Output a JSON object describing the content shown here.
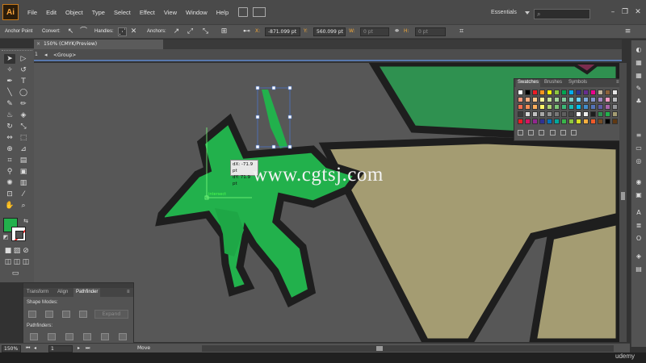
{
  "app": {
    "logo": "Ai"
  },
  "menu": [
    "File",
    "Edit",
    "Object",
    "Type",
    "Select",
    "Effect",
    "View",
    "Window",
    "Help"
  ],
  "workspace": "Essentials",
  "search_placeholder": "",
  "control_bar": {
    "tool_label": "Anchor Point",
    "convert_label": "Convert:",
    "handles_label": "Handles:",
    "anchors_label": "Anchors:",
    "x_label": "X:",
    "x_value": "-871.099 pt",
    "y_label": "Y:",
    "y_value": "560.099 pt",
    "w_label": "W:",
    "w_value": "0 pt",
    "h_label": "H:",
    "h_value": "0 pt"
  },
  "document_tab": {
    "close": "×",
    "title": "150% (CMYK/Preview)"
  },
  "breadcrumb": {
    "layer_num": "1",
    "group": "<Group>"
  },
  "swatches_panel": {
    "tabs": [
      "Swatches",
      "Brushes",
      "Symbols"
    ],
    "active_tab": "Swatches"
  },
  "pathfinder_panel": {
    "tabs": [
      "Transform",
      "Align",
      "Pathfinder"
    ],
    "active_tab": "Pathfinder",
    "shape_modes_label": "Shape Modes:",
    "expand_label": "Expand",
    "pathfinders_label": "Pathfinders:"
  },
  "measure_tooltip": {
    "dx": "dX: -71.9 pt",
    "dy": "dY: 71.9 pt"
  },
  "smart_guide": "intersect",
  "status_bar": {
    "zoom": "150%",
    "artboard": "1",
    "tool_status": "Move"
  },
  "watermark": "www.cgtsj.com",
  "brand": "udemy",
  "colors": {
    "figure_green": "#22b14c",
    "outline": "#1e1e1e",
    "khaki": "#a49c72",
    "dark_green": "#2f9150",
    "canvas_gray": "#575757",
    "selection_blue": "#5878ad"
  }
}
